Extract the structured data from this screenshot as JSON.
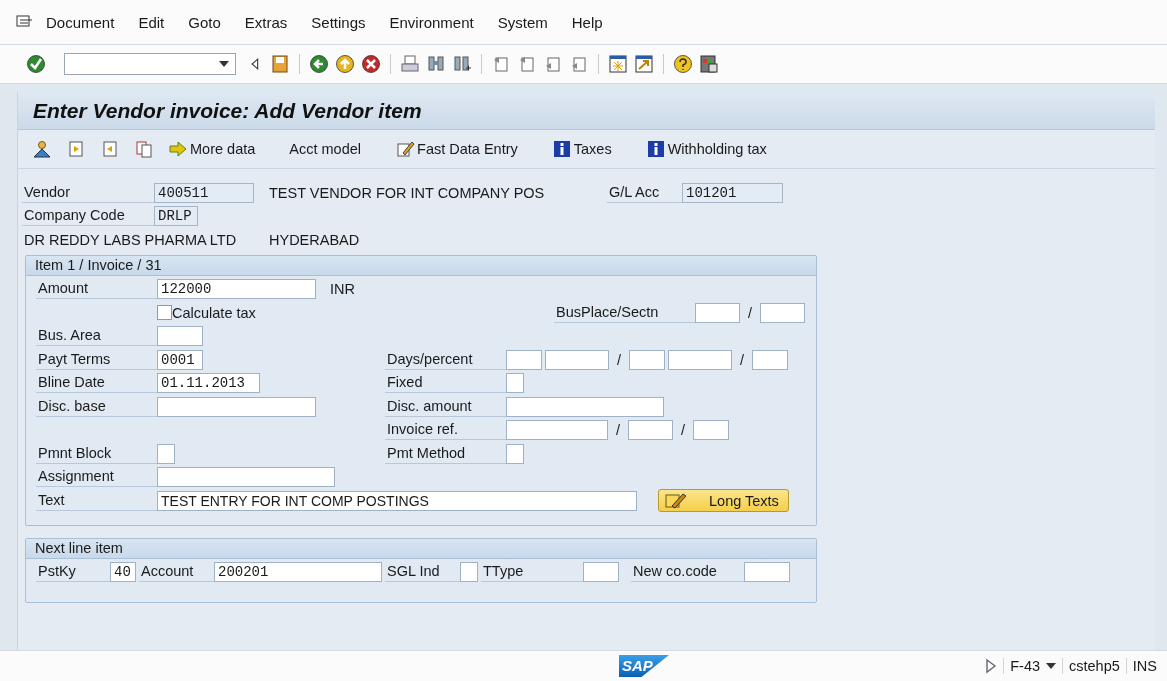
{
  "menu": [
    {
      "label": "Document"
    },
    {
      "label": "Edit"
    },
    {
      "label": "Goto"
    },
    {
      "label": "Extras"
    },
    {
      "label": "Settings"
    },
    {
      "label": "Environment"
    },
    {
      "label": "System"
    },
    {
      "label": "Help"
    }
  ],
  "title": "Enter Vendor invoice: Add Vendor item",
  "app_toolbar": [
    {
      "kind": "person"
    },
    {
      "kind": "doc-prev"
    },
    {
      "kind": "doc-next"
    },
    {
      "kind": "copy"
    },
    {
      "kind": "arrow",
      "label": "More data"
    },
    {
      "kind": "plain",
      "label": "Acct model"
    },
    {
      "kind": "edit",
      "label": "Fast Data Entry"
    },
    {
      "kind": "info",
      "label": "Taxes"
    },
    {
      "kind": "info",
      "label": "Withholding tax"
    }
  ],
  "header": {
    "vendor": {
      "label": "Vendor",
      "value": "400511",
      "name": "TEST VENDOR FOR INT COMPANY POS"
    },
    "gl_acc": {
      "label": "G/L Acc",
      "value": "101201"
    },
    "company_code": {
      "label": "Company Code",
      "value": "DRLP"
    },
    "company_name": "DR REDDY LABS PHARMA LTD",
    "city": "HYDERABAD"
  },
  "item": {
    "title": "Item 1 / Invoice / 31",
    "amount": {
      "label": "Amount",
      "value": "122000",
      "currency": "INR"
    },
    "calculate_tax": {
      "label": "Calculate tax",
      "checked": false
    },
    "busplace": {
      "label": "BusPlace/Sectn",
      "separator": "/"
    },
    "bus_area": {
      "label": "Bus. Area"
    },
    "payt_terms": {
      "label": "Payt Terms",
      "value": "0001"
    },
    "days_percent": {
      "label": "Days/percent",
      "separators": [
        "/",
        "/"
      ]
    },
    "bline_date": {
      "label": "Bline Date",
      "value": "01.11.2013"
    },
    "fixed": {
      "label": "Fixed"
    },
    "disc_base": {
      "label": "Disc. base"
    },
    "disc_amount": {
      "label": "Disc. amount"
    },
    "invoice_ref": {
      "label": "Invoice ref.",
      "separators": [
        "/",
        "/"
      ]
    },
    "pmnt_block": {
      "label": "Pmnt Block"
    },
    "pmt_method": {
      "label": "Pmt Method"
    },
    "assignment": {
      "label": "Assignment"
    },
    "text": {
      "label": "Text",
      "value": "TEST ENTRY FOR INT COMP POSTINGS"
    },
    "long_texts_button": "Long Texts"
  },
  "next_line": {
    "title": "Next line item",
    "pstky": {
      "label": "PstKy",
      "value": "40"
    },
    "account": {
      "label": "Account",
      "value": "200201"
    },
    "sgl_ind": {
      "label": "SGL Ind"
    },
    "ttype": {
      "label": "TType"
    },
    "new_co_code": {
      "label": "New co.code"
    }
  },
  "status": {
    "logo": "SAP",
    "transaction": "F-43",
    "system": "cstehp5",
    "mode": "INS"
  }
}
